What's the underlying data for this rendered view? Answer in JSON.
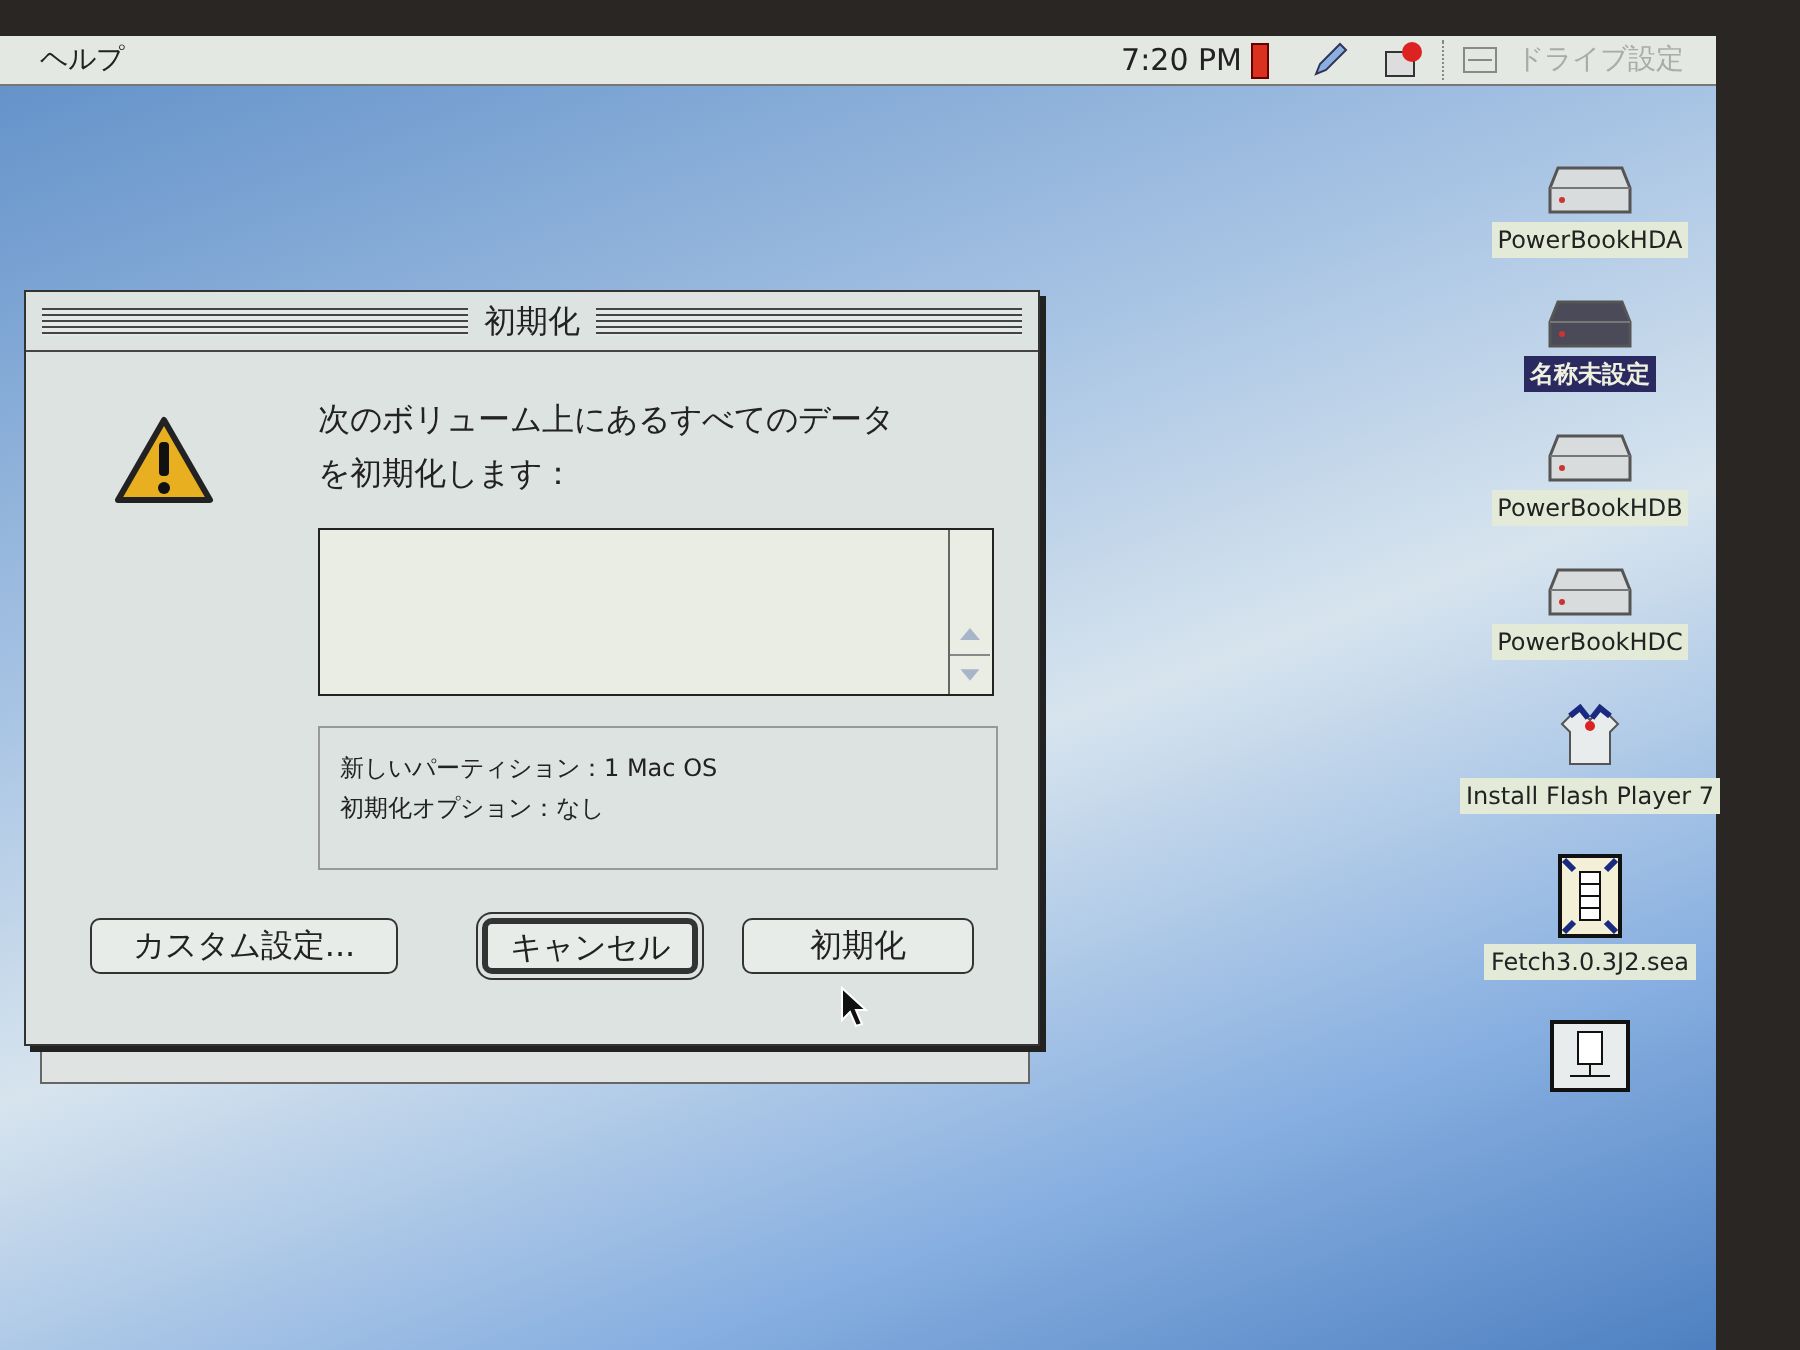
{
  "menu_bar": {
    "items": [
      {
        "label": "ヘルプ"
      }
    ],
    "clock": "7:20 PM",
    "application": {
      "label": "ドライブ設定",
      "disabled": true
    }
  },
  "dialog": {
    "title": "初期化",
    "message": "次のボリューム上にあるすべてのデータを初期化します：",
    "details": [
      "新しいパーティション：1 Mac OS",
      "初期化オプション：なし"
    ],
    "buttons": [
      {
        "label": "カスタム設定...",
        "default": false
      },
      {
        "label": "キャンセル",
        "default": true
      },
      {
        "label": "初期化",
        "default": false
      }
    ]
  },
  "desktop_icons": [
    {
      "label": "PowerBookHDA",
      "kind": "drive",
      "selected": false
    },
    {
      "label": "名称未設定",
      "kind": "drive",
      "selected": true
    },
    {
      "label": "PowerBookHDB",
      "kind": "drive",
      "selected": false
    },
    {
      "label": "PowerBookHDC",
      "kind": "drive",
      "selected": false
    },
    {
      "label": "Install Flash Player 7",
      "kind": "installer",
      "selected": false
    },
    {
      "label": "Fetch3.0.3J2.sea",
      "kind": "archive",
      "selected": false
    },
    {
      "kind": "network"
    }
  ]
}
